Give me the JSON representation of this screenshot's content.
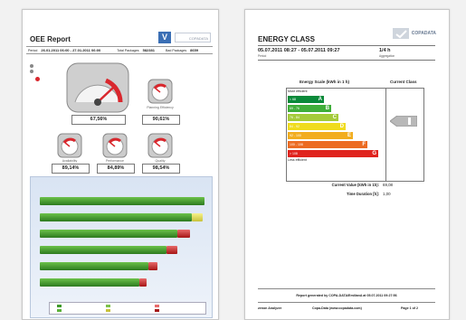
{
  "page1": {
    "title": "OEE Report",
    "logo_v": "V",
    "logo_text": "COPADATA",
    "meta": {
      "period_label": "Period",
      "period_value": "26.01.2011 06:00 - 27.01.2011 06:00",
      "total_label": "Total Packages",
      "total_value": "582381",
      "bad_label": "Bad Packages",
      "bad_value": "8659"
    },
    "gauges": [
      {
        "value": "67,56%",
        "label": ""
      },
      {
        "value": "90,61%",
        "label": "Planning Efficiency"
      },
      {
        "value": "89,14%",
        "label": "Availability"
      },
      {
        "value": "84,89%",
        "label": "Performance"
      },
      {
        "value": "98,54%",
        "label": "Quality"
      }
    ],
    "colors": {
      "gauge_red": "#d9272d",
      "bar_green": "#3f9a2a"
    }
  },
  "page2": {
    "title": "ENERGY CLASS",
    "logo_text": "COPADATA",
    "period_value": "05.07.2011 08:27 - 05.07.2011 09:27",
    "period_label": "Period",
    "aggregation_value": "1/4 h",
    "aggregation_label": "Aggregation",
    "scale_title": "Energy Scale (kWh in 1 h)",
    "current_title": "Current Class",
    "more_efficient": "More efficient",
    "less_efficient": "Less efficient",
    "classes": [
      {
        "range": "< 68",
        "cls": "A",
        "color": "#0a8a3a"
      },
      {
        "range": "69 - 76",
        "cls": "B",
        "color": "#3fae3a"
      },
      {
        "range": "76 - 84",
        "cls": "C",
        "color": "#a4cb3a"
      },
      {
        "range": "84 - 92",
        "cls": "D",
        "color": "#f0dc1e"
      },
      {
        "range": "92 - 100",
        "cls": "E",
        "color": "#f2ad1e"
      },
      {
        "range": "100 - 108",
        "cls": "F",
        "color": "#ec6b22"
      },
      {
        "range": "> 108",
        "cls": "G",
        "color": "#e0231d"
      }
    ],
    "current_value_label": "Current Value (kWh in 1h):",
    "current_value": "69,08",
    "duration_label": "Time Duration [h]:",
    "duration_value": "1,00",
    "generated_text": "Report generated by COPA-DATA\\EmilianA at 05.07.2011 09:27:56",
    "footer_left": "zenon Analyzer",
    "footer_center": "Copa-Data (www.copadata.com)",
    "footer_right": "Page 1 of 2"
  }
}
